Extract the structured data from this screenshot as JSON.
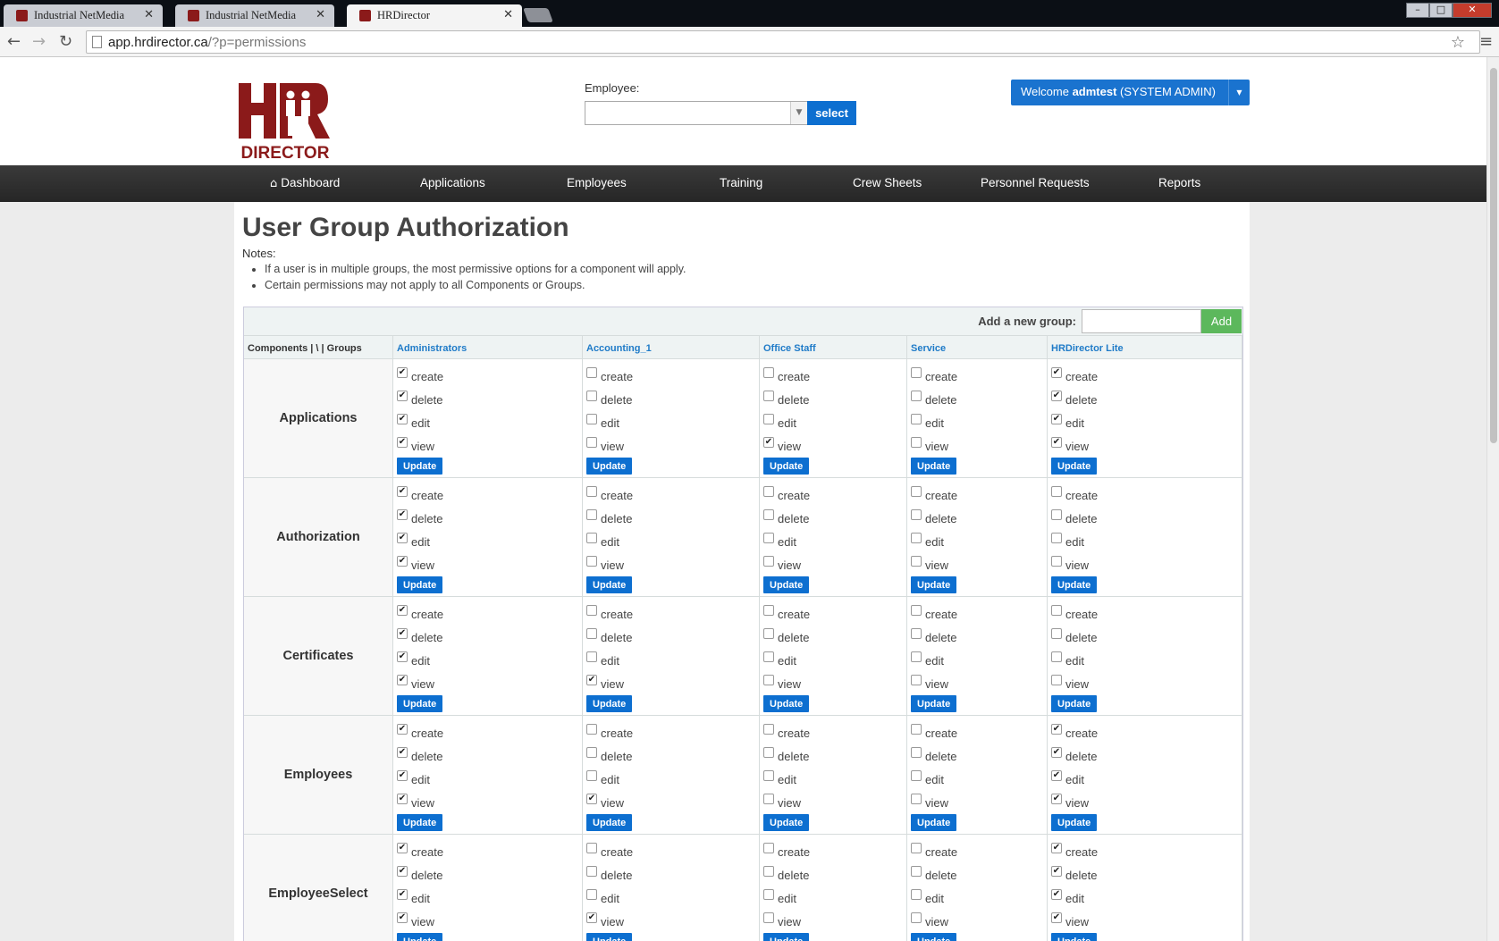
{
  "browser": {
    "tabs": [
      {
        "title": "Industrial NetMedia",
        "active": false
      },
      {
        "title": "Industrial NetMedia",
        "active": false
      },
      {
        "title": "HRDirector",
        "active": true
      }
    ],
    "url_host": "app.hrdirector.ca",
    "url_path": "/?p=permissions"
  },
  "header": {
    "employee_label": "Employee:",
    "employee_value": "",
    "select_label": "select",
    "welcome_prefix": "Welcome ",
    "welcome_user": "admtest",
    "welcome_role": " (SYSTEM ADMIN)"
  },
  "nav": [
    "Dashboard",
    "Applications",
    "Employees",
    "Training",
    "Crew Sheets",
    "Personnel Requests",
    "Reports"
  ],
  "page": {
    "title": "User Group Authorization",
    "notes_label": "Notes:",
    "notes": [
      "If a user is in multiple groups, the most permissive options for a component will apply.",
      "Certain permissions may not apply to all Components or Groups."
    ]
  },
  "table": {
    "add_group_label": "Add a new group:",
    "add_group_value": "",
    "add_button": "Add",
    "corner_header": "Components | \\ | Groups",
    "groups": [
      "Administrators",
      "Accounting_1",
      "Office Staff",
      "Service",
      "HRDirector Lite"
    ],
    "permissions": [
      "create",
      "delete",
      "edit",
      "view"
    ],
    "update_label": "Update",
    "components": [
      {
        "name": "Applications",
        "grants": [
          [
            1,
            1,
            1,
            1
          ],
          [
            0,
            0,
            0,
            0
          ],
          [
            0,
            0,
            0,
            1
          ],
          [
            0,
            0,
            0,
            0
          ],
          [
            1,
            1,
            1,
            1
          ]
        ]
      },
      {
        "name": "Authorization",
        "grants": [
          [
            1,
            1,
            1,
            1
          ],
          [
            0,
            0,
            0,
            0
          ],
          [
            0,
            0,
            0,
            0
          ],
          [
            0,
            0,
            0,
            0
          ],
          [
            0,
            0,
            0,
            0
          ]
        ]
      },
      {
        "name": "Certificates",
        "grants": [
          [
            1,
            1,
            1,
            1
          ],
          [
            0,
            0,
            0,
            1
          ],
          [
            0,
            0,
            0,
            0
          ],
          [
            0,
            0,
            0,
            0
          ],
          [
            0,
            0,
            0,
            0
          ]
        ]
      },
      {
        "name": "Employees",
        "grants": [
          [
            1,
            1,
            1,
            1
          ],
          [
            0,
            0,
            0,
            1
          ],
          [
            0,
            0,
            0,
            0
          ],
          [
            0,
            0,
            0,
            0
          ],
          [
            1,
            1,
            1,
            1
          ]
        ]
      },
      {
        "name": "EmployeeSelect",
        "grants": [
          [
            1,
            1,
            1,
            1
          ],
          [
            0,
            0,
            0,
            1
          ],
          [
            0,
            0,
            0,
            0
          ],
          [
            0,
            0,
            0,
            0
          ],
          [
            1,
            1,
            1,
            1
          ]
        ]
      }
    ]
  },
  "colors": {
    "brand": "#8b1a1a",
    "primary": "#0d6fd0",
    "success": "#5cb85c",
    "nav": "#2e2e2e"
  }
}
